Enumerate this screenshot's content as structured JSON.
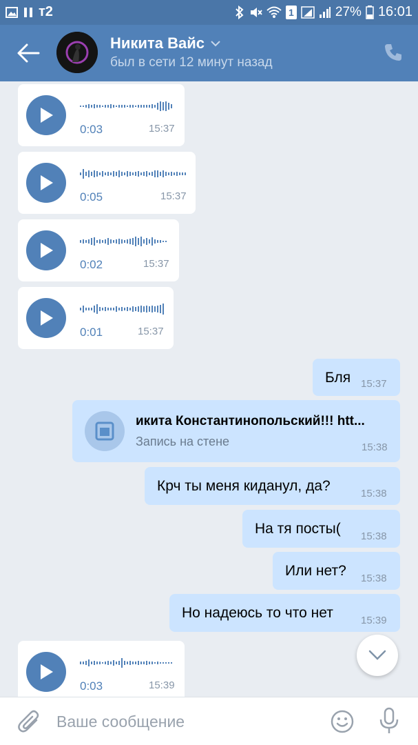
{
  "status_bar": {
    "carrier": "т2",
    "battery": "27%",
    "time": "16:01",
    "sim_badge": "1"
  },
  "header": {
    "contact_name": "Никита Вайс",
    "status": "был в сети 12 минут назад",
    "header_color": "#5181b8"
  },
  "messages": [
    {
      "type": "voice",
      "direction": "in",
      "duration": "0:03",
      "time": "15:37"
    },
    {
      "type": "voice",
      "direction": "in",
      "duration": "0:05",
      "time": "15:37"
    },
    {
      "type": "voice",
      "direction": "in",
      "duration": "0:02",
      "time": "15:37"
    },
    {
      "type": "voice",
      "direction": "in",
      "duration": "0:01",
      "time": "15:37"
    },
    {
      "type": "text",
      "direction": "out",
      "text": "Бля",
      "time": "15:37"
    },
    {
      "type": "wall_post",
      "direction": "out",
      "title": "икита Константинопольский!!! htt...",
      "subtitle": "Запись на стене",
      "time": "15:38"
    },
    {
      "type": "text",
      "direction": "out",
      "text": "Крч ты меня киданул, да?",
      "time": "15:38"
    },
    {
      "type": "text",
      "direction": "out",
      "text": "На тя посты(",
      "time": "15:38"
    },
    {
      "type": "text",
      "direction": "out",
      "text": "Или нет?",
      "time": "15:38"
    },
    {
      "type": "text",
      "direction": "out",
      "text": "Но надеюсь то что нет",
      "time": "15:39"
    },
    {
      "type": "voice",
      "direction": "in",
      "duration": "0:03",
      "time": "15:39"
    }
  ],
  "input": {
    "placeholder": "Ваше сообщение",
    "value": ""
  }
}
